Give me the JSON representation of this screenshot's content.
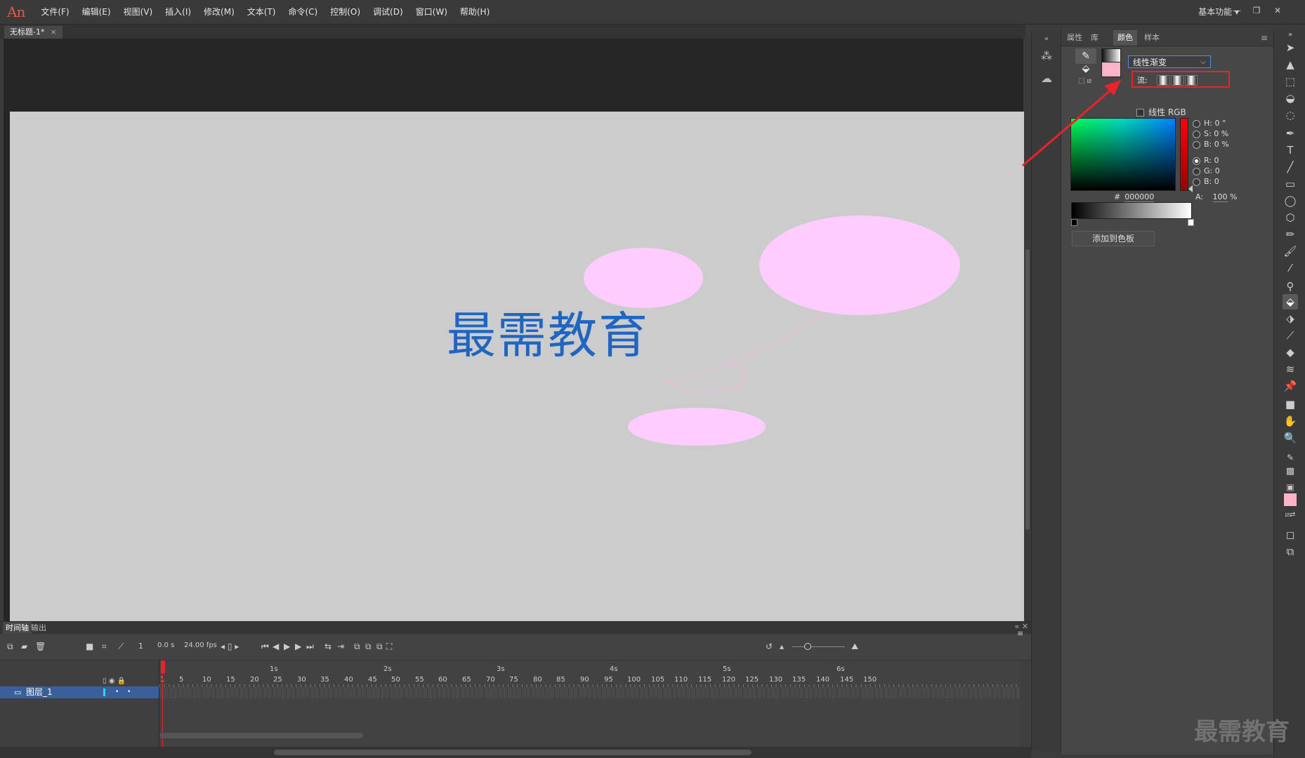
{
  "app": {
    "logo": "An"
  },
  "menu": [
    "文件(F)",
    "编辑(E)",
    "视图(V)",
    "插入(I)",
    "修改(M)",
    "文本(T)",
    "命令(C)",
    "控制(O)",
    "调试(D)",
    "窗口(W)",
    "帮助(H)"
  ],
  "workspace": "基本功能",
  "window_controls": {
    "minimize": "—",
    "restore": "❐",
    "close": "✕"
  },
  "document_tab": {
    "title": "无标题-1*",
    "close": "×"
  },
  "stage": {
    "title": "最需教育"
  },
  "color_panel": {
    "tabs": [
      "属性",
      "库",
      "颜色",
      "样本"
    ],
    "active_tab": "颜色",
    "fill_type": "线性渐变",
    "flow_label": "流:",
    "linear_rgb_label": "线性 RGB",
    "hsb": [
      {
        "label": "H:",
        "value": "0 °"
      },
      {
        "label": "S:",
        "value": "0 %"
      },
      {
        "label": "B:",
        "value": "0 %"
      }
    ],
    "rgb": [
      {
        "label": "R:",
        "value": "0"
      },
      {
        "label": "G:",
        "value": "0"
      },
      {
        "label": "B:",
        "value": "0"
      }
    ],
    "hex_label": "#",
    "hex": "000000",
    "alpha_label": "A:",
    "alpha": "100",
    "alpha_unit": "%",
    "add_button": "添加到色板",
    "fill_swatch_color": "#ffb3c8",
    "stroke_color": "#000000"
  },
  "timeline": {
    "tabs": [
      "时间轴",
      "输出"
    ],
    "frame": "1",
    "time": "0.0 s",
    "fps": "24.00 fps",
    "layer_name": "图层_1",
    "seconds": [
      "1s",
      "2s",
      "3s",
      "4s",
      "5s",
      "6s"
    ],
    "frame_numbers": [
      "1",
      "5",
      "10",
      "15",
      "20",
      "25",
      "30",
      "35",
      "40",
      "45",
      "50",
      "55",
      "60",
      "65",
      "70",
      "75",
      "80",
      "85",
      "90",
      "95",
      "100",
      "105",
      "110",
      "115",
      "120",
      "125",
      "130",
      "135",
      "140",
      "145",
      "150"
    ]
  },
  "watermark": "最需教育",
  "colors": {
    "accent_red": "#e8232a",
    "ellipse_pink": "#ffccff",
    "title_blue": "#1f66c2"
  }
}
